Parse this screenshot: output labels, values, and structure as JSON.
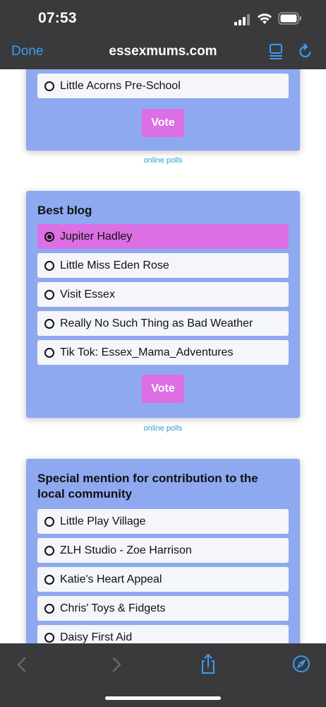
{
  "status_bar": {
    "time": "07:53"
  },
  "nav": {
    "done_label": "Done",
    "url": "essexmums.com"
  },
  "polls": [
    {
      "title": "",
      "options": [
        {
          "label": "Little Acorns Pre-School",
          "selected": false
        }
      ],
      "vote_label": "Vote",
      "link_label": "online polls"
    },
    {
      "title": "Best blog",
      "options": [
        {
          "label": "Jupiter Hadley",
          "selected": true
        },
        {
          "label": "Little Miss Eden Rose",
          "selected": false
        },
        {
          "label": "Visit Essex",
          "selected": false
        },
        {
          "label": "Really No Such Thing as Bad Weather",
          "selected": false
        },
        {
          "label": "Tik Tok: Essex_Mama_Adventures",
          "selected": false
        }
      ],
      "vote_label": "Vote",
      "link_label": "online polls"
    },
    {
      "title_line1": "Special mention for contribution to the",
      "title_line2": "local community",
      "options": [
        {
          "label": "Little Play Village",
          "selected": false
        },
        {
          "label": "ZLH Studio - Zoe Harrison",
          "selected": false
        },
        {
          "label": "Katie's Heart Appeal",
          "selected": false
        },
        {
          "label": "Chris' Toys & Fidgets",
          "selected": false
        },
        {
          "label": "Daisy First Aid",
          "selected": false
        }
      ]
    }
  ],
  "colors": {
    "card_background": "#8ea9f0",
    "selected_option": "#dc6fe4",
    "vote_button": "#dc6fe4",
    "link": "#2f9fcf",
    "chrome": "#3a3a3c",
    "accent": "#3b9bf5"
  },
  "icons": {
    "reader": "reader-mode-icon",
    "reload": "reload-icon",
    "back": "back-chevron-icon",
    "forward": "forward-chevron-icon",
    "share": "share-icon",
    "compass": "compass-icon"
  }
}
